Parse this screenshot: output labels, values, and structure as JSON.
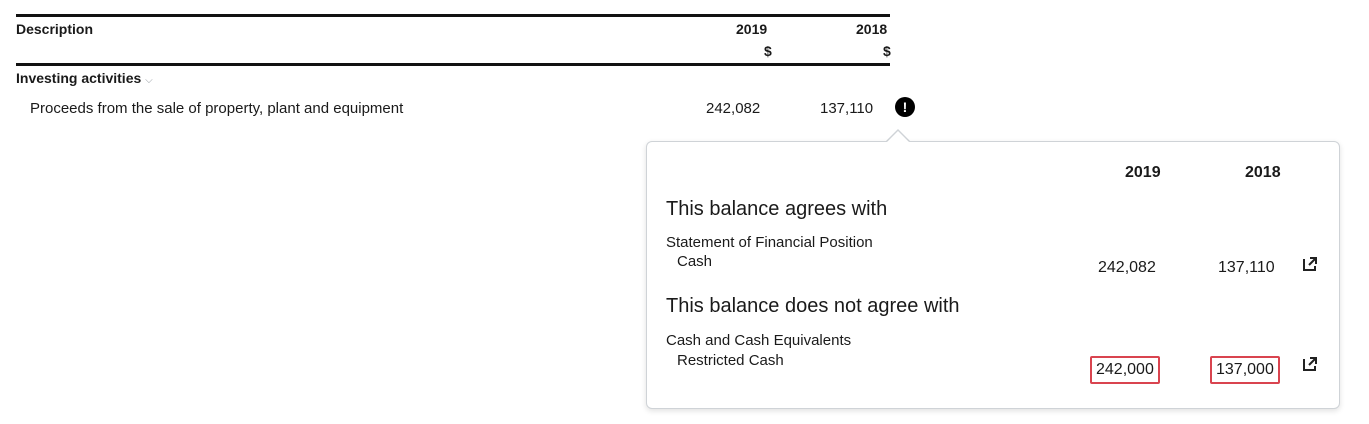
{
  "table": {
    "col_description": "Description",
    "col_2019": "2019",
    "col_2018": "2018",
    "currency_2019": "$",
    "currency_2018": "$",
    "section_label": "Investing activities",
    "row": {
      "label": "Proceeds from the sale of property, plant and equipment",
      "value_2019": "242,082",
      "value_2018": "137,110"
    },
    "alert_glyph": "!"
  },
  "popover": {
    "col_2019": "2019",
    "col_2018": "2018",
    "agrees_title": "This balance agrees with",
    "agrees_item": {
      "statement": "Statement of Financial Position",
      "account": "Cash",
      "value_2019": "242,082",
      "value_2018": "137,110"
    },
    "disagrees_title": "This balance does not agree with",
    "disagrees_item": {
      "statement": "Cash and Cash Equivalents",
      "account": "Restricted Cash",
      "value_2019": "242,000",
      "value_2018": "137,000"
    },
    "mismatch_color": "#d9444f"
  },
  "icons": {
    "section_toggle": "chevron-down-icon",
    "alert": "exclamation-circle-icon",
    "open_link": "external-link-icon"
  }
}
